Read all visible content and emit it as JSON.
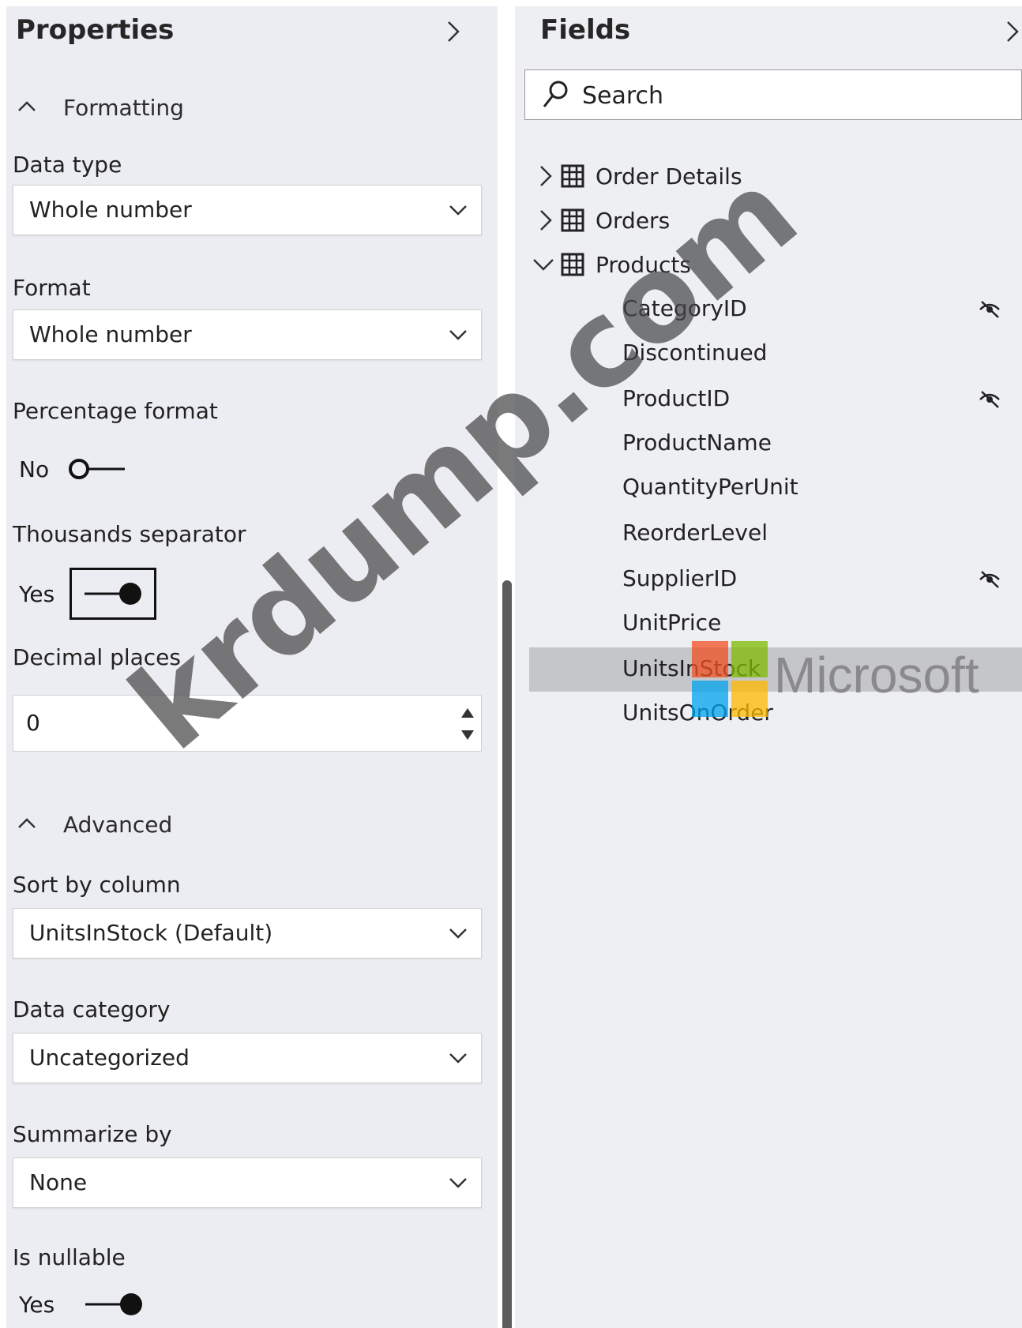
{
  "properties": {
    "title": "Properties",
    "formatting_section": "Formatting",
    "data_type": {
      "label": "Data type",
      "value": "Whole number"
    },
    "format": {
      "label": "Format",
      "value": "Whole number"
    },
    "percentage_format": {
      "label": "Percentage format",
      "state": "No"
    },
    "thousands_separator": {
      "label": "Thousands separator",
      "state": "Yes"
    },
    "decimal_places": {
      "label": "Decimal places",
      "value": "0"
    },
    "advanced_section": "Advanced",
    "sort_by_column": {
      "label": "Sort by column",
      "value": "UnitsInStock (Default)"
    },
    "data_category": {
      "label": "Data category",
      "value": "Uncategorized"
    },
    "summarize_by": {
      "label": "Summarize by",
      "value": "None"
    },
    "is_nullable": {
      "label": "Is nullable",
      "state": "Yes"
    }
  },
  "fields": {
    "title": "Fields",
    "search_placeholder": "Search",
    "tables": [
      {
        "name": "Order Details",
        "expanded": false
      },
      {
        "name": "Orders",
        "expanded": false
      },
      {
        "name": "Products",
        "expanded": true
      }
    ],
    "product_fields": [
      {
        "name": "CategoryID",
        "hidden": true
      },
      {
        "name": "Discontinued",
        "hidden": false
      },
      {
        "name": "ProductID",
        "hidden": true
      },
      {
        "name": "ProductName",
        "hidden": false
      },
      {
        "name": "QuantityPerUnit",
        "hidden": false
      },
      {
        "name": "ReorderLevel",
        "hidden": false
      },
      {
        "name": "SupplierID",
        "hidden": true
      },
      {
        "name": "UnitPrice",
        "hidden": false
      },
      {
        "name": "UnitsInStock",
        "hidden": false,
        "selected": true
      },
      {
        "name": "UnitsOnOrder",
        "hidden": false
      }
    ]
  },
  "watermark": {
    "text": "krdump.com",
    "brand": "Microsoft"
  },
  "colors": {
    "selected_row": "#c5c6ca",
    "panel_bg": "#ecedf2",
    "ms_red": "#f25022",
    "ms_green": "#7fba00",
    "ms_blue": "#00a4ef",
    "ms_yellow": "#ffb900"
  }
}
